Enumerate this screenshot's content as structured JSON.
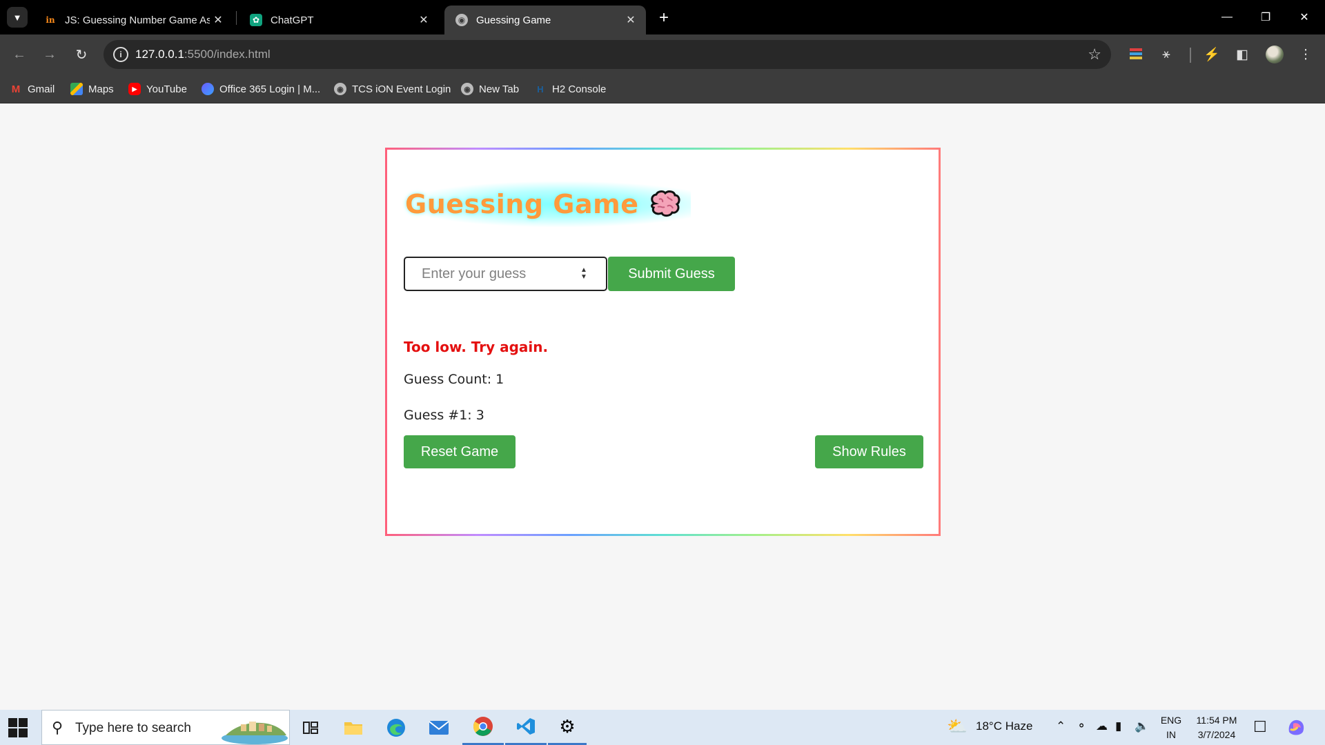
{
  "browser": {
    "tabs": [
      {
        "title": "JS: Guessing Number Game Ass",
        "favicon": "in-logo-icon",
        "active": false
      },
      {
        "title": "ChatGPT",
        "favicon": "chatgpt-icon",
        "active": false
      },
      {
        "title": "Guessing Game",
        "favicon": "globe-icon",
        "active": true
      }
    ],
    "url": {
      "host": "127.0.0.1",
      "rest": ":5500/index.html"
    },
    "bookmarks": [
      {
        "label": "Gmail",
        "icon": "gmail-icon"
      },
      {
        "label": "Maps",
        "icon": "maps-icon"
      },
      {
        "label": "YouTube",
        "icon": "youtube-icon"
      },
      {
        "label": "Office 365 Login | M...",
        "icon": "office-icon"
      },
      {
        "label": "TCS iON Event Login",
        "icon": "globe-icon"
      },
      {
        "label": "New Tab",
        "icon": "globe-icon"
      },
      {
        "label": "H2 Console",
        "icon": "h2-icon"
      }
    ]
  },
  "game": {
    "title": "Guessing Game",
    "input_placeholder": "Enter your guess",
    "submit_label": "Submit Guess",
    "message": "Too low. Try again.",
    "guess_count": "Guess Count: 1",
    "history": [
      "Guess #1: 3"
    ],
    "reset_label": "Reset Game",
    "rules_label": "Show Rules"
  },
  "colors": {
    "accent_green": "#45a74a",
    "message_red": "#e41010",
    "title_orange": "#ff9a3c",
    "title_glow": "#78ffff"
  },
  "taskbar": {
    "search_placeholder": "Type here to search",
    "weather": "18°C  Haze",
    "language": [
      "ENG",
      "IN"
    ],
    "time": "11:54 PM",
    "date": "3/7/2024"
  }
}
